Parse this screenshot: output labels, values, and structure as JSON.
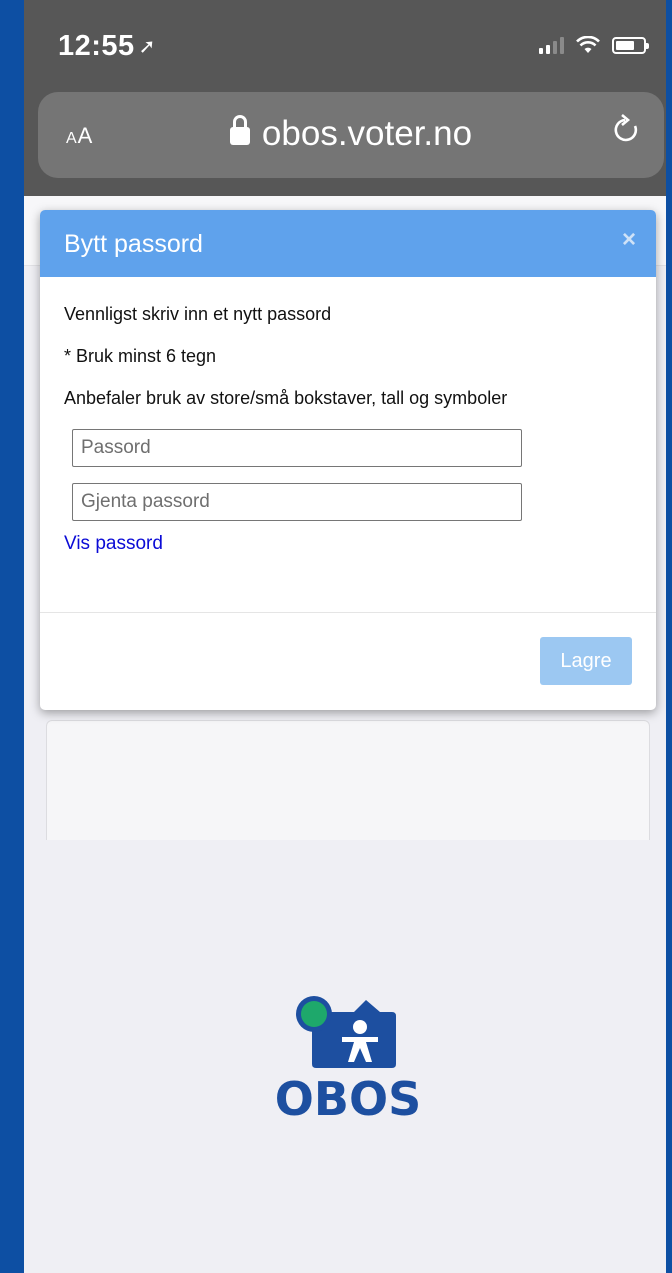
{
  "status_bar": {
    "time": "12:55",
    "location_arrow": "➚"
  },
  "browser": {
    "text_size_label": "AA",
    "url": "obos.voter.no",
    "reload_icon": "reload-icon"
  },
  "modal": {
    "title": "Bytt passord",
    "close_symbol": "×",
    "instruction": "Vennligst skriv inn et nytt passord",
    "min_length_note": "* Bruk minst 6 tegn",
    "recommendation": "Anbefaler bruk av store/små bokstaver, tall og symboler",
    "password_placeholder": "Passord",
    "repeat_placeholder": "Gjenta passord",
    "show_password_label": "Vis passord",
    "save_label": "Lagre"
  },
  "logo": {
    "text": "OBOS",
    "colors": {
      "brand_blue": "#1d4fa0",
      "dot_green": "#1ea86b"
    }
  },
  "colors": {
    "header_blue": "#5fa2ec",
    "save_button": "#9cc8f2",
    "link_blue": "#0b0bd6",
    "frame_blue": "#0d4fa3"
  }
}
